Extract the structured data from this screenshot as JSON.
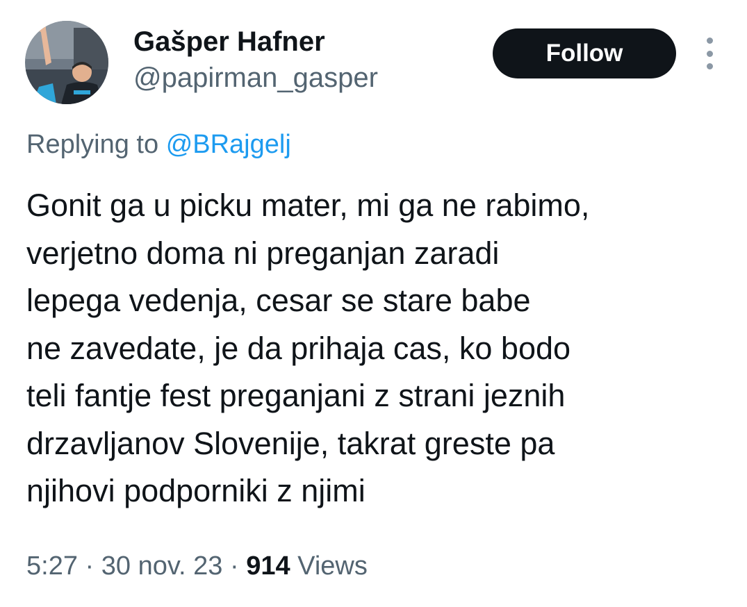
{
  "author": {
    "display_name": "Gašper Hafner",
    "handle": "@papirman_gasper",
    "avatar_icon": "profile-photo"
  },
  "actions": {
    "follow_label": "Follow",
    "more_icon": "more-vertical-icon"
  },
  "reply": {
    "prefix": "Replying to",
    "to_handle": "@BRajgelj"
  },
  "tweet": {
    "lines": [
      "Gonit ga u picku mater, mi ga ne rabimo,",
      "verjetno doma ni preganjan zaradi",
      "lepega vedenja, cesar se stare babe",
      "ne zavedate, je da prihaja cas, ko bodo",
      "teli fantje fest preganjani z strani jeznih",
      "drzavljanov Slovenije, takrat greste pa",
      "njihovi podporniki z njimi"
    ]
  },
  "meta": {
    "time": "5:27",
    "separator": "·",
    "date": "30 nov. 23",
    "views_count": "914",
    "views_label": "Views"
  },
  "colors": {
    "text": "#0f1419",
    "secondary": "#536471",
    "link": "#1d9bf0",
    "button_bg": "#0f1419",
    "button_text": "#ffffff"
  }
}
